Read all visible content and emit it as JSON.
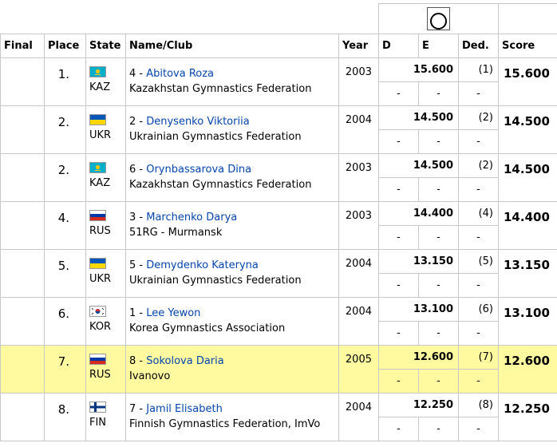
{
  "headers": {
    "final": "Final",
    "place": "Place",
    "state": "State",
    "name_club": "Name/Club",
    "year": "Year",
    "d": "D",
    "e": "E",
    "ded": "Ded.",
    "score": "Score",
    "apparatus_icon": "hoop-icon"
  },
  "rows": [
    {
      "place": "1.",
      "country": "KAZ",
      "flag": "kaz",
      "number": "4 - ",
      "gymnast": "Abitova Roza",
      "club": "Kazakhstan Gymnastics Federation",
      "year": "2003",
      "e": "15.600",
      "rank": "(1)",
      "d_sub": "-",
      "e_sub": "-",
      "ded_sub": "-",
      "score": "15.600",
      "highlight": false
    },
    {
      "place": "2.",
      "country": "UKR",
      "flag": "ukr",
      "number": "2 - ",
      "gymnast": "Denysenko Viktoriia",
      "club": "Ukrainian Gymnastics Federation",
      "year": "2004",
      "e": "14.500",
      "rank": "(2)",
      "d_sub": "-",
      "e_sub": "-",
      "ded_sub": "-",
      "score": "14.500",
      "highlight": false
    },
    {
      "place": "2.",
      "country": "KAZ",
      "flag": "kaz",
      "number": "6 - ",
      "gymnast": "Orynbassarova Dina",
      "club": "Kazakhstan Gymnastics Federation",
      "year": "2003",
      "e": "14.500",
      "rank": "(2)",
      "d_sub": "-",
      "e_sub": "-",
      "ded_sub": "-",
      "score": "14.500",
      "highlight": false
    },
    {
      "place": "4.",
      "country": "RUS",
      "flag": "rus",
      "number": "3 - ",
      "gymnast": "Marchenko Darya",
      "club": "51RG - Murmansk",
      "year": "2003",
      "e": "14.400",
      "rank": "(4)",
      "d_sub": "-",
      "e_sub": "-",
      "ded_sub": "-",
      "score": "14.400",
      "highlight": false
    },
    {
      "place": "5.",
      "country": "UKR",
      "flag": "ukr",
      "number": "5 - ",
      "gymnast": "Demydenko Kateryna",
      "club": "Ukrainian Gymnastics Federation",
      "year": "2004",
      "e": "13.150",
      "rank": "(5)",
      "d_sub": "-",
      "e_sub": "-",
      "ded_sub": "-",
      "score": "13.150",
      "highlight": false
    },
    {
      "place": "6.",
      "country": "KOR",
      "flag": "kor",
      "number": "1 - ",
      "gymnast": "Lee Yewon",
      "club": "Korea Gymnastics Association",
      "year": "2004",
      "e": "13.100",
      "rank": "(6)",
      "d_sub": "-",
      "e_sub": "-",
      "ded_sub": "-",
      "score": "13.100",
      "highlight": false
    },
    {
      "place": "7.",
      "country": "RUS",
      "flag": "rus",
      "number": "8 - ",
      "gymnast": "Sokolova Daria",
      "club": "Ivanovo",
      "year": "2005",
      "e": "12.600",
      "rank": "(7)",
      "d_sub": "-",
      "e_sub": "-",
      "ded_sub": "-",
      "score": "12.600",
      "highlight": true
    },
    {
      "place": "8.",
      "country": "FIN",
      "flag": "fin",
      "number": "7 - ",
      "gymnast": "Jamil Elisabeth",
      "club": "Finnish Gymnastics Federation, ImVo",
      "year": "2004",
      "e": "12.250",
      "rank": "(8)",
      "d_sub": "-",
      "e_sub": "-",
      "ded_sub": "-",
      "score": "12.250",
      "highlight": false
    }
  ],
  "colors": {
    "link": "#0645ad",
    "highlight": "#fffaa0",
    "border": "#c8c8c8"
  }
}
